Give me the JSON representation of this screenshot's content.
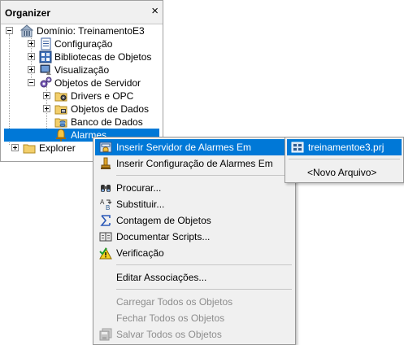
{
  "organizer": {
    "title": "Organizer",
    "close_glyph": "×",
    "tree": [
      {
        "label": "Domínio: TreinamentoE3",
        "icon": "domain-icon",
        "expander": "minus"
      },
      {
        "label": "Configuração",
        "icon": "list-icon",
        "expander": "plus"
      },
      {
        "label": "Bibliotecas de Objetos",
        "icon": "library-icon",
        "expander": "plus"
      },
      {
        "label": "Visualização",
        "icon": "monitor-icon",
        "expander": "plus"
      },
      {
        "label": "Objetos de Servidor",
        "icon": "gears-icon",
        "expander": "minus"
      },
      {
        "label": "Drivers e OPC",
        "icon": "folder-driver-icon",
        "expander": "plus"
      },
      {
        "label": "Objetos de Dados",
        "icon": "folder-data-icon",
        "expander": "plus"
      },
      {
        "label": "Banco de Dados",
        "icon": "folder-database-icon",
        "expander": "none"
      },
      {
        "label": "Alarmes",
        "icon": "alarm-icon",
        "expander": "none",
        "selected": true
      },
      {
        "label": "Explorer",
        "icon": "folder-icon",
        "expander": "plus"
      }
    ]
  },
  "context_menu": {
    "items": [
      {
        "label": "Inserir Servidor de Alarmes Em",
        "icon": "alarm-server-icon",
        "submenu": true,
        "highlighted": true
      },
      {
        "label": "Inserir Configuração de Alarmes Em",
        "icon": "alarm-config-icon",
        "submenu": true
      },
      {
        "label": "Procurar...",
        "icon": "binoculars-icon"
      },
      {
        "label": "Substituir...",
        "icon": "replace-icon"
      },
      {
        "label": "Contagem de Objetos",
        "icon": "sigma-icon"
      },
      {
        "label": "Documentar Scripts...",
        "icon": "book-icon"
      },
      {
        "label": "Verificação",
        "icon": "check-warning-icon"
      },
      {
        "label": "Editar Associações..."
      },
      {
        "label": "Carregar Todos os Objetos",
        "disabled": true
      },
      {
        "label": "Fechar Todos os Objetos",
        "disabled": true
      },
      {
        "label": "Salvar Todos os Objetos",
        "icon": "save-all-icon",
        "disabled": true
      }
    ]
  },
  "submenu": {
    "items": [
      {
        "label": "treinamentoe3.prj",
        "icon": "project-icon",
        "highlighted": true
      },
      {
        "label": "<Novo Arquivo>"
      }
    ]
  },
  "colors": {
    "selection": "#0078d7",
    "menu_background": "#f0f0f0",
    "disabled_text": "#8d8d8d"
  }
}
